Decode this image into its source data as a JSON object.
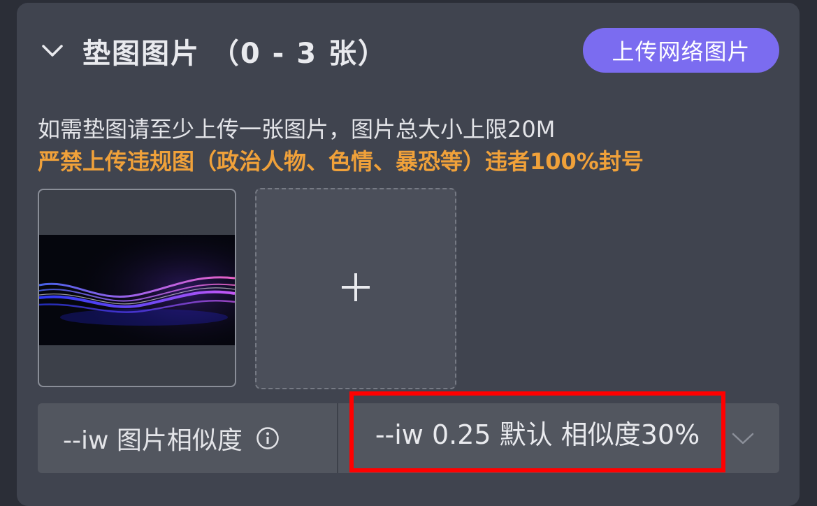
{
  "section": {
    "title": "垫图图片 （0 - 3 张）",
    "upload_button": "上传网络图片",
    "description": "如需垫图请至少上传一张图片，图片总大小上限20M",
    "warning": "严禁上传违规图（政治人物、色情、暴恐等）违者100%封号"
  },
  "images": {
    "add_icon": "plus-icon",
    "thumbnail_icon": "image-thumbnail"
  },
  "similarity": {
    "label": "--iw 图片相似度",
    "info_icon": "info-icon",
    "selected": "--iw 0.25 默认 相似度30%",
    "dropdown_icon": "chevron-down-icon"
  },
  "colors": {
    "panel_bg": "#40444f",
    "accent": "#7b6cf0",
    "warning": "#f0a13a",
    "highlight": "#ff0000"
  }
}
